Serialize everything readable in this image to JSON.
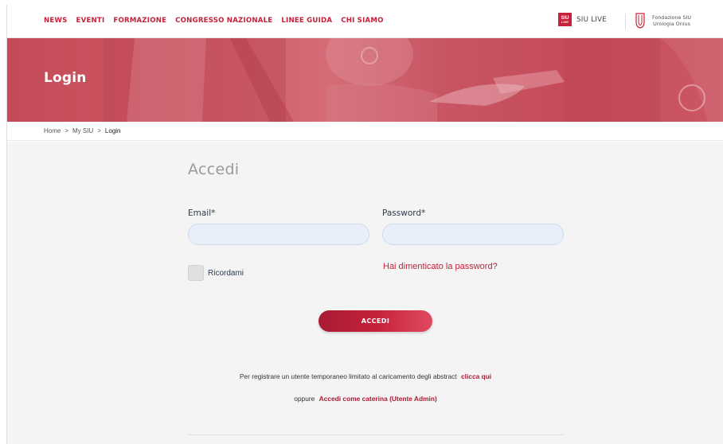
{
  "nav": {
    "items": [
      "NEWS",
      "EVENTI",
      "FORMAZIONE",
      "CONGRESSO NAZIONALE",
      "LINEE GUIDA",
      "CHI SIAMO"
    ],
    "siu_live_label": "SIU LIVE",
    "siu_live_logo_top": "SIU",
    "siu_live_logo_bottom": "LIVE",
    "fondazione_line1": "Fondazione SIU",
    "fondazione_line2": "Urologia Onlus"
  },
  "hero": {
    "title": "Login"
  },
  "breadcrumb": {
    "items": [
      "Home",
      "My SIU",
      "Login"
    ],
    "separator": ">"
  },
  "form": {
    "title": "Accedi",
    "email_label": "Email*",
    "email_value": "",
    "password_label": "Password*",
    "password_value": "",
    "remember_label": "Ricordami",
    "remember_checked": false,
    "forgot_link": "Hai dimenticato la password?",
    "submit_label": "ACCEDI"
  },
  "footer_note": {
    "line1_text": "Per registrare un utente temporaneo limitato al caricamento degli abstract",
    "line1_link": "clicca qui",
    "line2_prefix": "oppure",
    "line2_link": "Accedi come caterina (Utente Admin)"
  },
  "colors": {
    "brand_red": "#c4213a",
    "input_bg": "#e8effb",
    "content_bg": "#f4f4f4"
  }
}
